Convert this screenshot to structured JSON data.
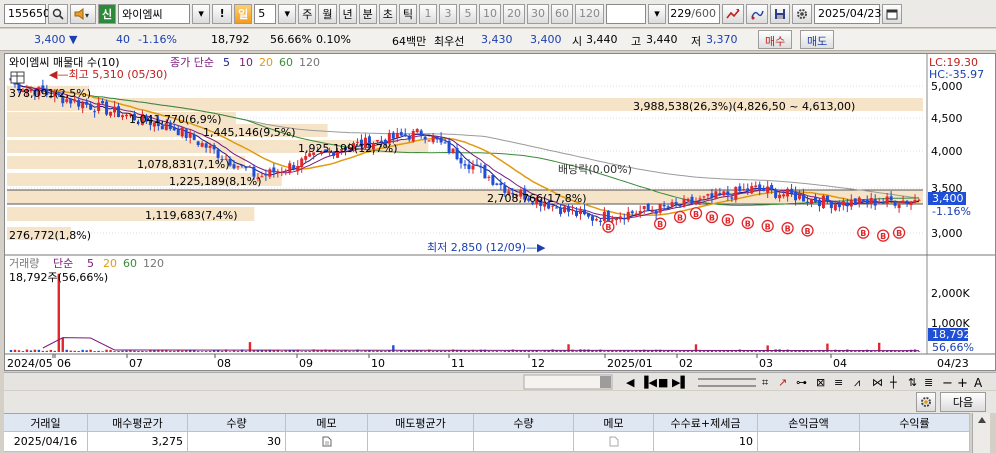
{
  "toolbar": {
    "code": "155650",
    "new_badge": "신",
    "name": "와이엠씨",
    "warn": "!",
    "period_label": "일",
    "period_value": "5",
    "periods": [
      "주",
      "월",
      "년",
      "분",
      "초",
      "틱"
    ],
    "numbers": [
      "1",
      "3",
      "5",
      "10",
      "20",
      "30",
      "60",
      "120"
    ],
    "count": "229",
    "count_max": "/600",
    "date": "2025/04/23"
  },
  "quote": {
    "price": "3,400",
    "change": "40",
    "change_pct": "-1.16%",
    "volume": "18,792",
    "vol_ratio": "56.66%",
    "turnover": "0.10%",
    "hoga_label": "64백만",
    "best_label": "최우선",
    "best_ask": "3,430",
    "best_bid": "3,400",
    "open_label": "시",
    "open": "3,440",
    "high_label": "고",
    "high": "3,440",
    "low_label": "저",
    "low": "3,370",
    "buy_btn": "매수",
    "sell_btn": "매도"
  },
  "chart": {
    "title": "와이엠씨 매물대 수(10)",
    "ma_label": "종가 단순",
    "ma_periods": [
      "5",
      "10",
      "20",
      "60",
      "120"
    ],
    "lc": "LC:19.30",
    "hc": "HC:-35.97",
    "high_note": "최고 5,310 (05/30)",
    "low_note": "최저 2,850 (12/09)",
    "dividend_note": "배당락(0.00%)",
    "price_ticks": [
      "5,000",
      "4,500",
      "4,000",
      "3,500",
      "3,000"
    ],
    "last_price_tag": "3,400",
    "last_pct_tag": "-1.16%",
    "volume_profile": [
      {
        "label": "378,091(2,5%)"
      },
      {
        "label": "1,041,770(6,9%)"
      },
      {
        "label": "1,445,146(9,5%)"
      },
      {
        "label": "1,078,831(7,1%)"
      },
      {
        "label": "1,925,199(12,7%)"
      },
      {
        "label": "1,225,189(8,1%)"
      },
      {
        "label": "2,708,766(17,8%)"
      },
      {
        "label": "1,119,683(7,4%)"
      },
      {
        "label": "276,772(1,8%)"
      },
      {
        "label": "3,988,538(26,3%)(4,826,50 ~ 4,613,00)"
      }
    ],
    "volume_title": "거래량",
    "volume_ma_label": "단순",
    "volume_ma_periods": [
      "5",
      "20",
      "60",
      "120"
    ],
    "volume_now": "18,792주(56,66%)",
    "volume_ticks": [
      "2,000K",
      "1,000K"
    ],
    "volume_tag": "18,792",
    "volume_pct_tag": "56,66%",
    "x_labels": [
      "2024/05",
      "06",
      "07",
      "08",
      "09",
      "10",
      "11",
      "12",
      "2025/01",
      "02",
      "03",
      "04",
      "04/23"
    ]
  },
  "chart_data": {
    "type": "candlestick",
    "x": [
      "2024/05",
      "2024/06",
      "2024/07",
      "2024/08",
      "2024/09",
      "2024/10",
      "2024/11",
      "2024/12",
      "2025/01",
      "2025/02",
      "2025/03",
      "2025/04"
    ],
    "close": [
      4950,
      4650,
      4350,
      3700,
      4100,
      4300,
      3550,
      3150,
      3300,
      3550,
      3350,
      3400
    ],
    "ylim": [
      2700,
      5300
    ],
    "volume_ylim": [
      0,
      2400000
    ]
  },
  "panel": {
    "next_btn": "다음",
    "columns": [
      "거래일",
      "매수평균가",
      "수량",
      "메모",
      "매도평균가",
      "수량",
      "메모",
      "수수료+제세금",
      "손익금액",
      "수익률"
    ],
    "row": [
      "2025/04/16",
      "3,275",
      "30",
      "",
      "",
      "",
      "",
      "10",
      "",
      ""
    ]
  },
  "colors": {
    "up": "#e0282c",
    "down": "#1f4fd6",
    "profile": "#f6e4c9"
  }
}
